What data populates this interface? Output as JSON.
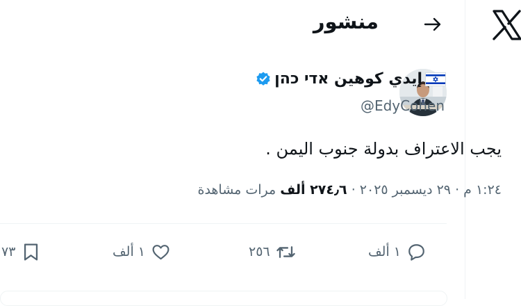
{
  "header": {
    "title": "منشور"
  },
  "tweet": {
    "display_name": "إيدي كوهين אדי כהן",
    "handle": "@EdyCohen",
    "text": "يجب الاعتراف بدولة جنوب اليمن .",
    "time": "١:٢٤ م",
    "date": "٢٩ ديسمبر ٢٠٢٥",
    "separator": "·",
    "views_count": "٢٧٤٫٦ ألف",
    "views_label": "مرات مشاهدة"
  },
  "actions": {
    "reply_count": "١ ألف",
    "retweet_count": "٢٥٦",
    "like_count": "١ ألف",
    "bookmark_count": "٧٣"
  },
  "colors": {
    "verified": "#1d9bf0",
    "muted": "#536471",
    "text": "#0f1419",
    "flag_blue": "#0038b8"
  },
  "icons": [
    "x-logo-icon",
    "back-arrow-icon",
    "israel-flag-icon",
    "verified-badge-icon",
    "reply-icon",
    "retweet-icon",
    "like-icon",
    "bookmark-icon"
  ]
}
